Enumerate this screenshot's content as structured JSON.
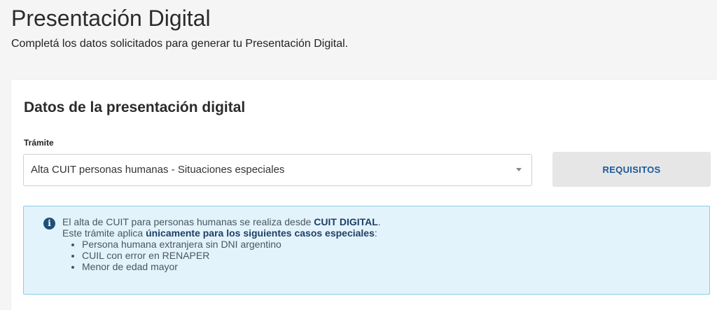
{
  "header": {
    "title": "Presentación Digital",
    "subtitle": "Completá los datos solicitados para generar tu Presentación Digital."
  },
  "card": {
    "title": "Datos de la presentación digital",
    "tramite_label": "Trámite",
    "tramite_value": "Alta CUIT personas humanas - Situaciones especiales",
    "requisitos_label": "REQUISITOS"
  },
  "info": {
    "line1_prefix": "El alta de CUIT para personas humanas se realiza desde ",
    "line1_strong": "CUIT DIGITAL",
    "line1_suffix": ".",
    "line2_prefix": "Este trámite aplica ",
    "line2_strong": "únicamente para los siguientes casos especiales",
    "line2_suffix": ":",
    "items": [
      "Persona humana extranjera sin DNI argentino",
      "CUIL con error en RENAPER",
      "Menor de edad mayor"
    ]
  },
  "icons": {
    "info": "info-icon",
    "dropdown": "chevron-down-icon"
  },
  "colors": {
    "button_text": "#1a5a9a",
    "info_bg": "#e3f3fb",
    "info_border": "#8ccde9",
    "info_icon": "#1f4e79"
  }
}
